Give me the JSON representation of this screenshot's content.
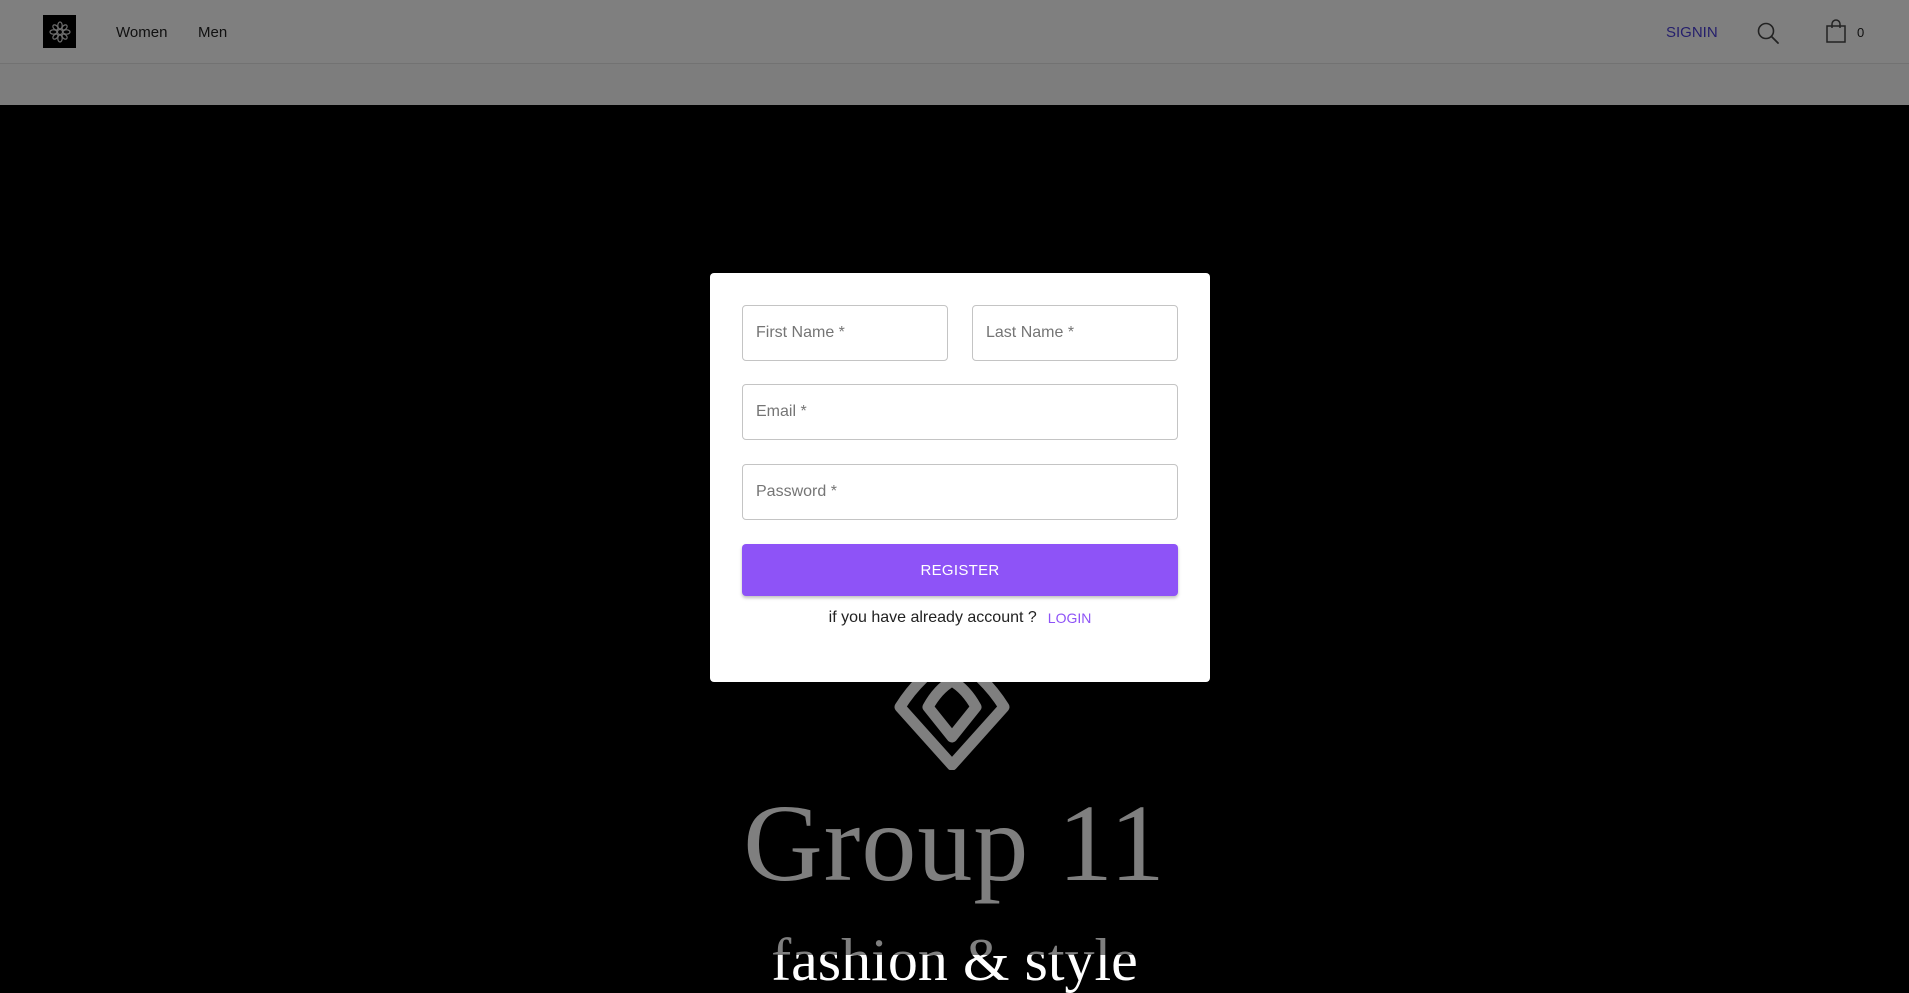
{
  "header": {
    "nav": [
      "Women",
      "Men"
    ],
    "signin_label": "SIGNIN",
    "cart_count": "0",
    "icons": {
      "logo": "flower-logo-icon",
      "search": "search-icon",
      "cart": "shopping-bag-icon"
    }
  },
  "hero": {
    "title": "Group 11",
    "subtitle": "fashion & style"
  },
  "register_form": {
    "first_name_placeholder": "First Name *",
    "last_name_placeholder": "Last Name *",
    "email_placeholder": "Email *",
    "password_placeholder": "Password *",
    "register_label": "REGISTER",
    "login_prompt": "if you have already account ?",
    "login_label": "LOGIN"
  },
  "colors": {
    "accent": "#8e53f7",
    "signin": "#4b3fd8",
    "overlay": "rgba(0,0,0,0.5)"
  }
}
